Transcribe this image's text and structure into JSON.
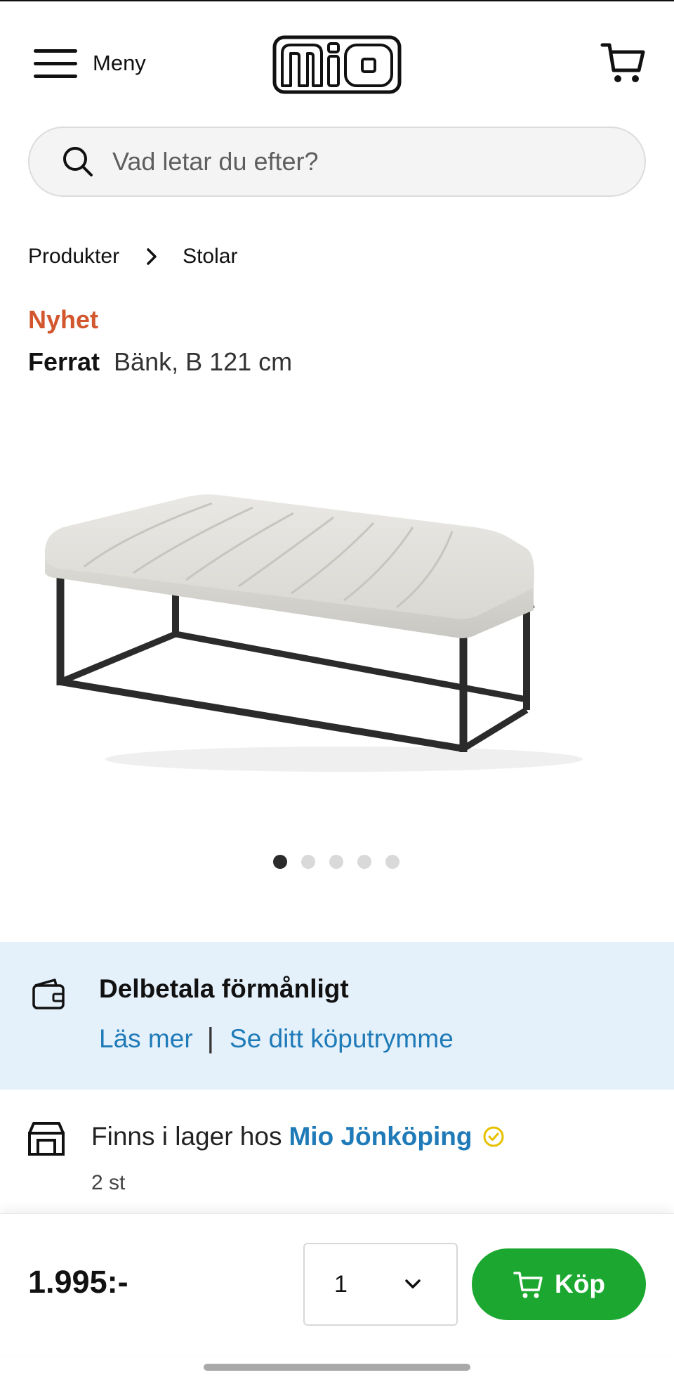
{
  "header": {
    "menu_label": "Meny",
    "logo_text": "mio"
  },
  "search": {
    "placeholder": "Vad letar du efter?"
  },
  "breadcrumb": [
    "Produkter",
    "Stolar"
  ],
  "product": {
    "badge": "Nyhet",
    "brand": "Ferrat",
    "description": "Bänk, B 121 cm",
    "image_count": 5,
    "active_image": 1
  },
  "installment": {
    "title": "Delbetala förmånligt",
    "link_read_more": "Läs mer",
    "separator": "|",
    "link_credit": "Se ditt köputrymme"
  },
  "stock": {
    "text": "Finns i lager hos",
    "store": "Mio Jönköping",
    "count": "2 st"
  },
  "buybar": {
    "price": "1.995:-",
    "quantity": "1",
    "buy_label": "Köp"
  },
  "colors": {
    "accent_green": "#1ca830",
    "link_blue": "#1f7ab8",
    "new_badge": "#d2572e",
    "banner_bg": "#e5f1fa",
    "check_yellow": "#e6c100"
  },
  "icons": [
    "menu-icon",
    "cart-icon",
    "search-icon",
    "chevron-right-icon",
    "wallet-icon",
    "store-icon",
    "check-circle-icon",
    "chevron-down-icon"
  ]
}
